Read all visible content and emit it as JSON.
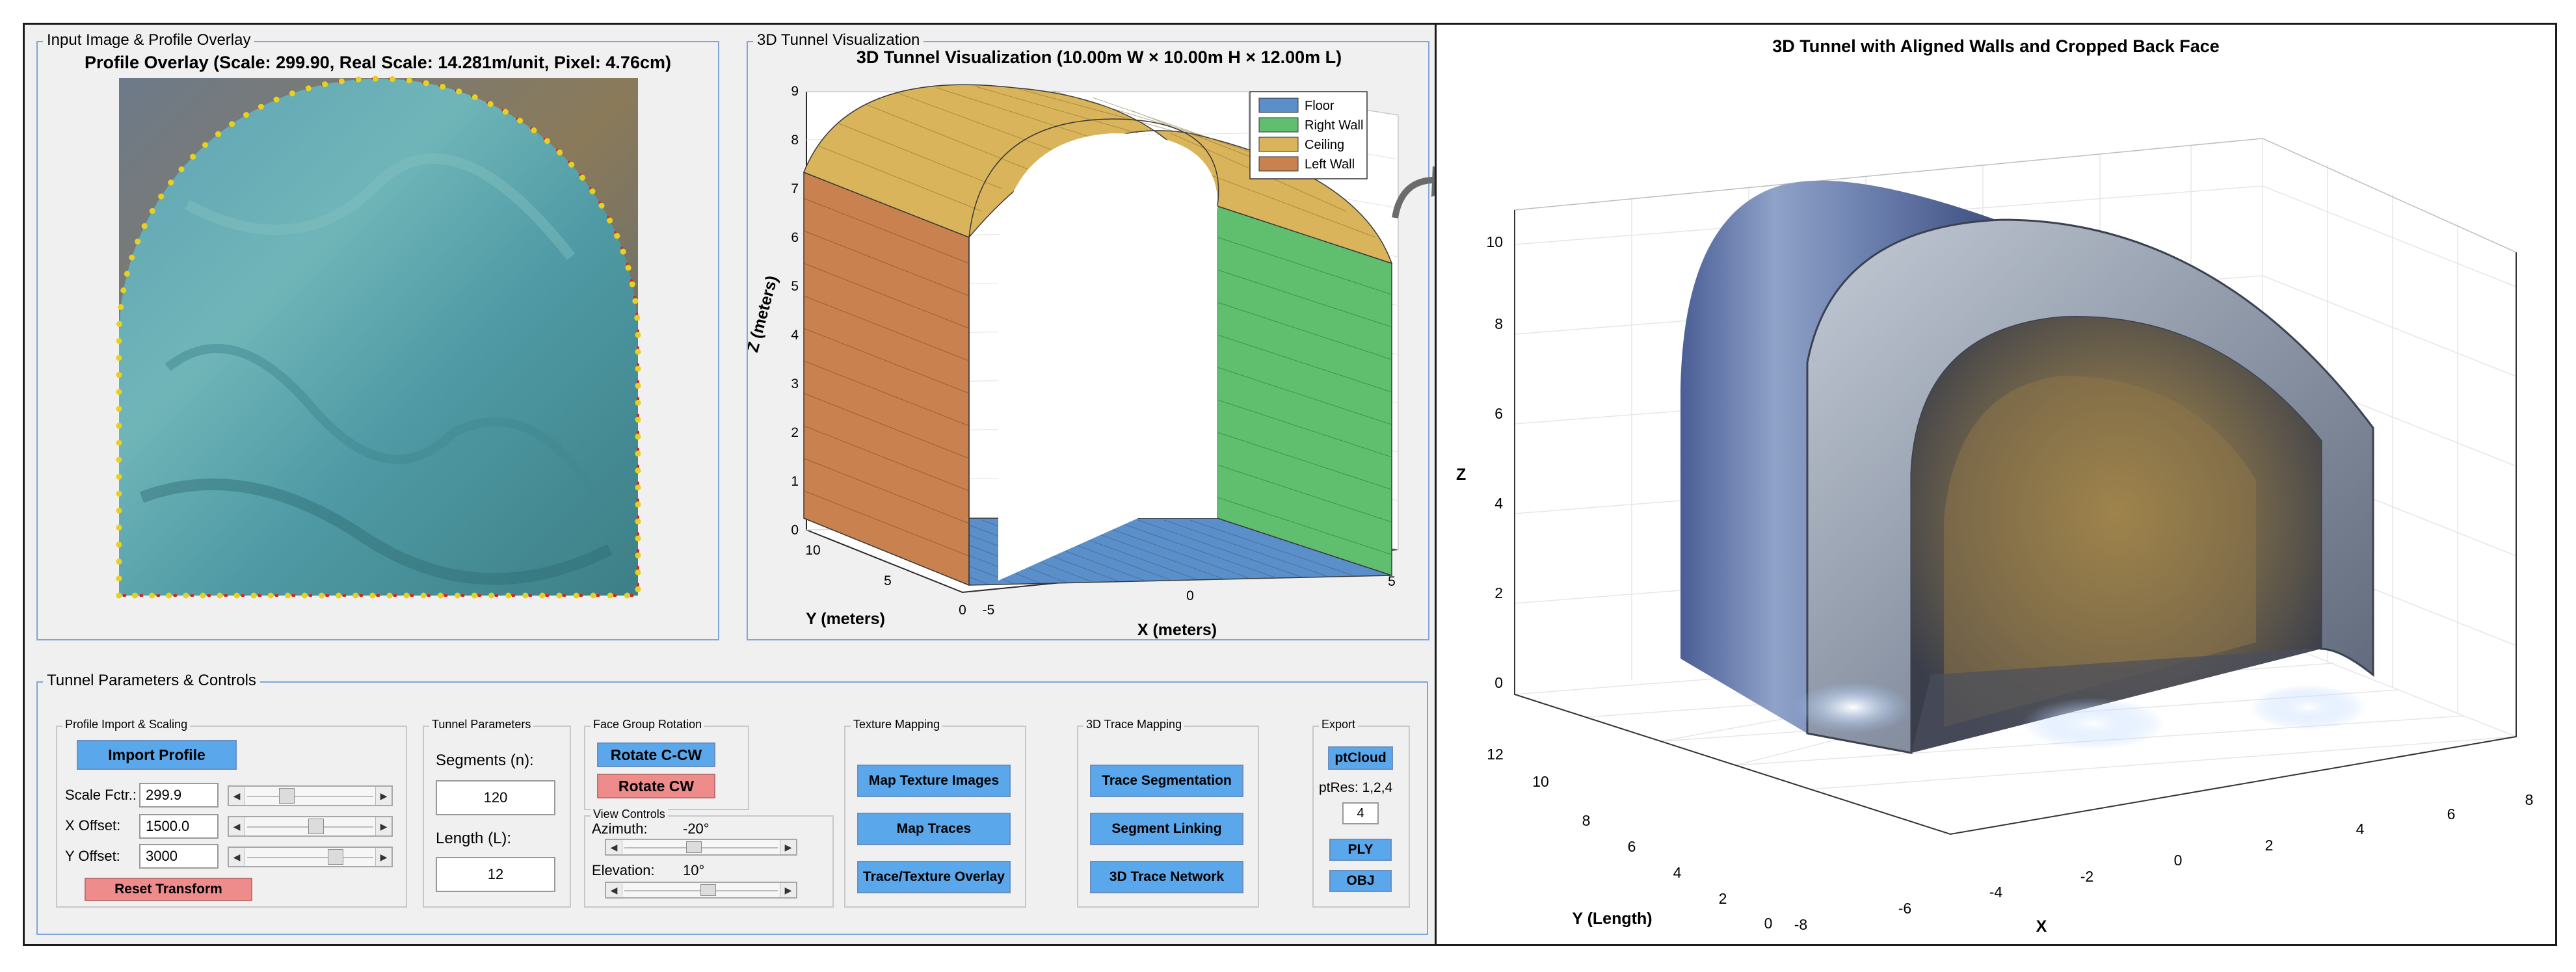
{
  "input_panel": {
    "title": "Input Image & Profile Overlay",
    "overlay_title": "Profile Overlay (Scale: 299.90, Real Scale: 14.281m/unit, Pixel: 4.76cm)"
  },
  "viz_panel": {
    "title": "3D Tunnel Visualization",
    "plot_title": "3D Tunnel Visualization (10.00m W × 10.00m H × 12.00m L)",
    "z_label": "Z (meters)",
    "y_label": "Y (meters)",
    "x_label": "X (meters)",
    "z_ticks": [
      "0",
      "1",
      "2",
      "3",
      "4",
      "5",
      "6",
      "7",
      "8",
      "9"
    ],
    "y_ticks": [
      "0",
      "5",
      "10"
    ],
    "x_ticks": [
      "-5",
      "0",
      "5"
    ],
    "legend": [
      {
        "name": "Floor",
        "color": "#5b8fc9"
      },
      {
        "name": "Right Wall",
        "color": "#5fbf6f"
      },
      {
        "name": "Ceiling",
        "color": "#d9b45a"
      },
      {
        "name": "Left Wall",
        "color": "#c9824f"
      }
    ]
  },
  "controls": {
    "title": "Tunnel Parameters & Controls",
    "profile": {
      "title": "Profile Import & Scaling",
      "import_label": "Import Profile",
      "scale_label": "Scale Fctr.:",
      "scale_value": "299.9",
      "scale_level": 0.3,
      "xoff_label": "X Offset:",
      "xoff_value": "1500.0",
      "xoff_level": 0.55,
      "yoff_label": "Y Offset:",
      "yoff_value": "3000",
      "yoff_level": 0.72,
      "reset_label": "Reset Transform"
    },
    "tunnel": {
      "title": "Tunnel Parameters",
      "segments_label": "Segments (n):",
      "segments_value": "120",
      "length_label": "Length (L):",
      "length_value": "12"
    },
    "face": {
      "title": "Face Group Rotation",
      "ccw_label": "Rotate C-CW",
      "cw_label": "Rotate CW"
    },
    "view": {
      "title": "View Controls",
      "azimuth_label": "Azimuth:",
      "azimuth_value": "-20°",
      "azimuth_level": 0.45,
      "elevation_label": "Elevation:",
      "elevation_value": "10°",
      "elevation_level": 0.55
    },
    "texture": {
      "title": "Texture Mapping",
      "map_texture": "Map Texture Images",
      "map_traces": "Map Traces",
      "overlay": "Trace/Texture Overlay"
    },
    "trace": {
      "title": "3D Trace Mapping",
      "segmentation": "Trace Segmentation",
      "linking": "Segment Linking",
      "network": "3D Trace Network"
    },
    "export": {
      "title": "Export",
      "ptcloud": "ptCloud",
      "ptres_label": "ptRes: 1,2,4",
      "ptres_value": "4",
      "ply": "PLY",
      "obj": "OBJ"
    }
  },
  "render": {
    "title": "3D Tunnel with Aligned Walls and Cropped Back Face",
    "z_label": "Z",
    "y_label": "Y (Length)",
    "x_label": "X",
    "z_ticks": [
      "0",
      "2",
      "4",
      "6",
      "8",
      "10"
    ],
    "y_ticks": [
      "0",
      "2",
      "4",
      "6",
      "8",
      "10",
      "12"
    ],
    "x_ticks": [
      "-8",
      "-6",
      "-4",
      "-2",
      "0",
      "2",
      "4",
      "6",
      "8"
    ]
  }
}
